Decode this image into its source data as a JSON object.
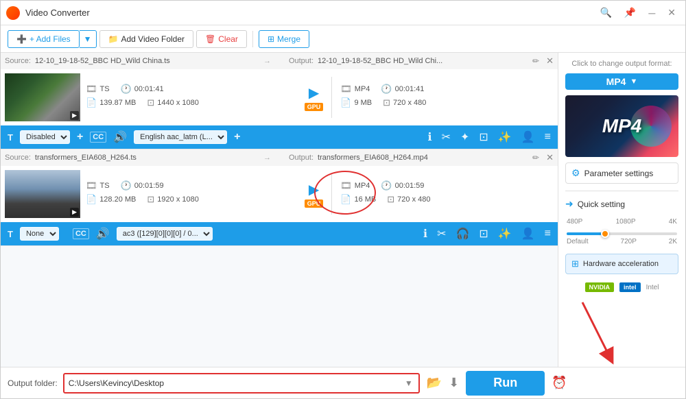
{
  "window": {
    "title": "Video Converter",
    "logo": "🎬"
  },
  "toolbar": {
    "add_files": "+ Add Files",
    "add_folder": "Add Video Folder",
    "clear": "Clear",
    "merge": "Merge"
  },
  "file1": {
    "source_label": "Source:",
    "source_name": "12-10_19-18-52_BBC HD_Wild China.ts",
    "output_label": "Output:",
    "output_name": "12-10_19-18-52_BBC HD_Wild Chi...",
    "source_format": "TS",
    "source_duration": "00:01:41",
    "source_size": "139.87 MB",
    "source_resolution": "1440 x 1080",
    "output_format": "MP4",
    "output_duration": "00:01:41",
    "output_size": "9 MB",
    "output_resolution": "720 x 480",
    "subtitle_label": "Disabled",
    "audio_label": "English aac_latm (L..."
  },
  "file2": {
    "source_label": "Source:",
    "source_name": "transformers_EIA608_H264.ts",
    "output_label": "Output:",
    "output_name": "transformers_EIA608_H264.mp4",
    "source_format": "TS",
    "source_duration": "00:01:59",
    "source_size": "128.20 MB",
    "source_resolution": "1920 x 1080",
    "output_format": "MP4",
    "output_duration": "00:01:59",
    "output_size": "16 MB",
    "output_resolution": "720 x 480",
    "subtitle_label": "None",
    "audio_label": "ac3 ([129][0][0][0] / 0..."
  },
  "right_panel": {
    "format_hint": "Click to change output format:",
    "format_name": "MP4",
    "param_settings": "Parameter settings",
    "quick_setting": "Quick setting",
    "quality_labels_top": [
      "480P",
      "1080P",
      "4K"
    ],
    "quality_labels_bottom": [
      "Default",
      "720P",
      "2K"
    ],
    "hw_accel": "Hardware acceleration",
    "nvidia": "NVIDIA",
    "intel_logo": "intel",
    "intel_text": "Intel"
  },
  "bottom": {
    "output_folder_label": "Output folder:",
    "output_folder_path": "C:\\Users\\Kevincy\\Desktop",
    "run_button": "Run"
  },
  "icons": {
    "add": "➕",
    "folder": "📁",
    "clear": "🗑️",
    "merge": "⊞",
    "arrow_right": "▶",
    "close": "✕",
    "edit": "✏️",
    "film": "🎞",
    "clock": "🕐",
    "size": "📄",
    "resolution": "⊡",
    "gpu": "GPU",
    "settings": "⚙",
    "arrow_pointer": "➜",
    "subtitle": "T",
    "caption": "CC",
    "audio": "🔊",
    "plus": "+",
    "info": "ℹ",
    "scissors": "✂",
    "headphone": "🎧",
    "crop": "⊡",
    "effect": "✨",
    "rotate": "↻",
    "person": "👤",
    "tune": "≡",
    "dropdown": "▼",
    "browse_folder": "📂",
    "import": "⬇",
    "clock_bottom": "⏰"
  }
}
